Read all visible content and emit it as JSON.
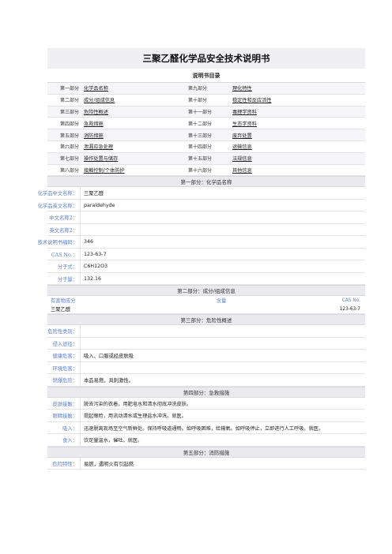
{
  "title": "三聚乙醛化学品安全技术说明书",
  "toc": {
    "heading": "说明书目录",
    "rows": [
      [
        "第一部分",
        "化学品名称",
        "第九部分",
        "理化特性"
      ],
      [
        "第二部分",
        "成分/组成信息",
        "第十部分",
        "稳定性和反应活性"
      ],
      [
        "第三部分",
        "危险性概述",
        "第十一部分",
        "毒理学资料"
      ],
      [
        "第四部分",
        "急救措施",
        "第十二部分",
        "生态学资料"
      ],
      [
        "第五部分",
        "消防措施",
        "第十三部分",
        "废弃处置"
      ],
      [
        "第六部分",
        "泄漏应急处理",
        "第十四部分",
        "运输信息"
      ],
      [
        "第七部分",
        "操作处置与储存",
        "第十五部分",
        "法规信息"
      ],
      [
        "第八部分",
        "接触控制/个体防护",
        "第十六部分",
        "其他信息"
      ]
    ]
  },
  "section1": {
    "heading": "第一部分：化学品名称",
    "rows": [
      {
        "k": "化学品中文名称：",
        "v": "三聚乙醛"
      },
      {
        "k": "化学品英文名称：",
        "v": "paraldehyde"
      },
      {
        "k": "中文名称2：",
        "v": ""
      },
      {
        "k": "英文名称2：",
        "v": ""
      },
      {
        "k": "技术说明书编码：",
        "v": "346"
      },
      {
        "k": "CAS No.：",
        "v": "123-63-7"
      },
      {
        "k": "分子式：",
        "v": "C6H12O3"
      },
      {
        "k": "分子量：",
        "v": "132.16"
      }
    ]
  },
  "section2": {
    "heading": "第二部分：成分/组成信息",
    "col1": "有害物成分",
    "col2": "含量",
    "col3": "CAS No.",
    "row": {
      "name": "三聚乙醛",
      "content": "",
      "cas": "123-63-7"
    }
  },
  "section3": {
    "heading": "第三部分：危险性概述",
    "rows": [
      {
        "k": "危险性类别：",
        "v": ""
      },
      {
        "k": "侵入途径：",
        "v": ""
      },
      {
        "k": "健康危害：",
        "v": "吸入、口服或经皮肤吸"
      },
      {
        "k": "环境危害：",
        "v": ""
      },
      {
        "k": "燃爆危险：",
        "v": "本品易燃，具刺激性。"
      }
    ]
  },
  "section4": {
    "heading": "第四部分：急救措施",
    "rows": [
      {
        "k": "皮肤接触：",
        "v": "脱去污染的衣着，用肥皂水和清水彻底冲洗皮肤。"
      },
      {
        "k": "眼睛接触：",
        "v": "提起眼睑，用流动清水或生理盐水冲洗。就医。"
      },
      {
        "k": "吸入：",
        "v": "迅速脱离现场至空气新鲜处。保持呼吸道通畅。如呼吸困难，给输氧。如呼吸停止，立即进行人工呼吸。就医。"
      },
      {
        "k": "食入：",
        "v": "饮足量温水，催吐。就医。"
      }
    ]
  },
  "section5": {
    "heading": "第五部分：消防措施",
    "rows": [
      {
        "k": "危险特性：",
        "v": "易燃，遇明火有引起燃"
      }
    ]
  }
}
